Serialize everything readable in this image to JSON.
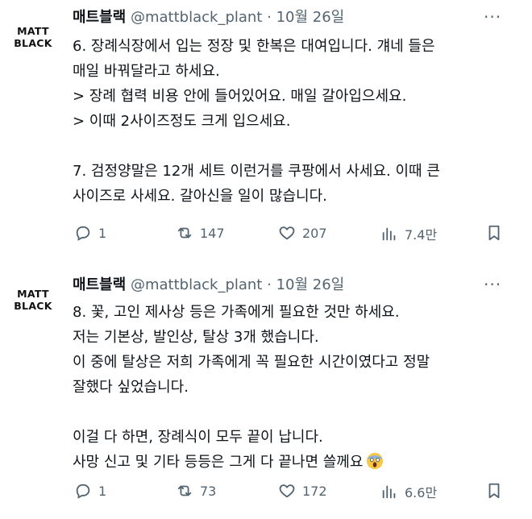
{
  "tweets": [
    {
      "avatar_lines": [
        "MATT",
        "BLACK"
      ],
      "display_name": "매트블랙",
      "handle": "@mattblack_plant",
      "separator": "·",
      "date": "10월 26일",
      "more_glyph": "···",
      "lines": [
        "6. 장례식장에서 입는 정장 및 한복은 대여입니다. 걔네 들은",
        "매일 바꿔달라고 하세요.",
        "> 장례 협력 비용 안에 들어있어요. 매일 갈아입으세요.",
        "> 이때 2사이즈정도 크게 입으세요.",
        "",
        "7. 검정양말은 12개 세트 이런거를 쿠팡에서 사세요. 이때 큰",
        "사이즈로 사세요. 갈아신을 일이 많습니다."
      ],
      "stats": {
        "replies": "1",
        "retweets": "147",
        "likes": "207",
        "views": "7.4만"
      }
    },
    {
      "avatar_lines": [
        "MATT",
        "BLACK"
      ],
      "display_name": "매트블랙",
      "handle": "@mattblack_plant",
      "separator": "·",
      "date": "10월 26일",
      "more_glyph": "···",
      "lines": [
        "8. 꽃, 고인 제사상 등은 가족에게 필요한 것만 하세요.",
        "저는 기본상, 발인상, 탈상 3개 했습니다.",
        "이 중에 탈상은 저희 가족에게 꼭 필요한 시간이였다고 정말",
        "잘했다 싶었습니다.",
        "",
        "이걸 다 하면, 장례식이 모두 끝이 납니다.",
        "사망 신고 및 기타 등등은 그게 다 끝나면 쓸께요"
      ],
      "emoji": "screaming-face-icon",
      "stats": {
        "replies": "1",
        "retweets": "73",
        "likes": "172",
        "views": "6.6만"
      }
    }
  ],
  "colors": {
    "text": "#0f1419",
    "secondary": "#536471",
    "emoji_yellow": "#f7c846"
  }
}
